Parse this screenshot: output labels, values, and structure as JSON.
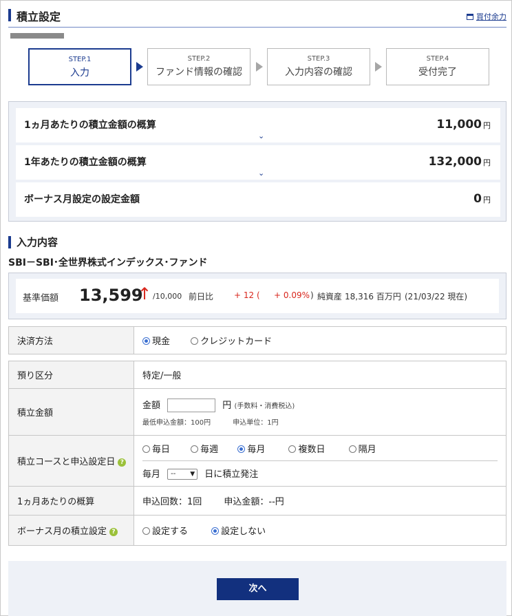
{
  "header": {
    "title": "積立設定",
    "link_label": "買付余力"
  },
  "steps": [
    {
      "num": "STEP.1",
      "label": "入力"
    },
    {
      "num": "STEP.2",
      "label": "ファンド情報の確認"
    },
    {
      "num": "STEP.3",
      "label": "入力内容の確認"
    },
    {
      "num": "STEP.4",
      "label": "受付完了"
    }
  ],
  "summary": [
    {
      "label": "1ヵ月あたりの積立金額の概算",
      "amount": "11,000",
      "unit": "円"
    },
    {
      "label": "1年あたりの積立金額の概算",
      "amount": "132,000",
      "unit": "円"
    },
    {
      "label": "ボーナス月設定の設定金額",
      "amount": "0",
      "unit": "円"
    }
  ],
  "section": {
    "title": "入力内容"
  },
  "fund": {
    "name": "SBI－SBI･全世界株式インデックス･ファンド"
  },
  "price": {
    "label": "基準価額",
    "value": "13,599",
    "arrow": "↑",
    "denominator": "/10,000",
    "change_label": "前日比",
    "change": "+ 12 (",
    "change_pct": "+ 0.09%",
    "change_close": ")",
    "nav_label": "純資産",
    "nav_value": "18,316 百万円",
    "as_of": "(21/03/22 現在)"
  },
  "payment": {
    "label": "決済方法",
    "options": [
      {
        "label": "現金",
        "selected": true
      },
      {
        "label": "クレジットカード",
        "selected": false
      }
    ]
  },
  "form": {
    "deposit": {
      "label": "預り区分",
      "value": "特定/一般"
    },
    "amount": {
      "label": "積立金額",
      "prefix": "金額",
      "input_value": "",
      "unit": "円",
      "note": "(手数料・消費税込)",
      "min_label": "最低申込金額：100円",
      "unit_label": "申込単位：1円"
    },
    "course": {
      "label": "積立コースと申込設定日",
      "options": [
        {
          "label": "毎日",
          "selected": false
        },
        {
          "label": "毎週",
          "selected": false
        },
        {
          "label": "毎月",
          "selected": true
        },
        {
          "label": "複数日",
          "selected": false
        },
        {
          "label": "隔月",
          "selected": false
        }
      ],
      "day_prefix": "毎月",
      "day_select": "--",
      "day_suffix": "日に積立発注"
    },
    "monthly": {
      "label": "1ヵ月あたりの概算",
      "count": "申込回数：1回",
      "amount": "申込金額：--円"
    },
    "bonus": {
      "label": "ボーナス月の積立設定",
      "options": [
        {
          "label": "設定する",
          "selected": false
        },
        {
          "label": "設定しない",
          "selected": true
        }
      ]
    }
  },
  "footer": {
    "next_label": "次へ"
  },
  "colors": {
    "brand": "#1b3b8f",
    "up": "#d8261c",
    "help": "#9bc13a",
    "panel": "#eef1f7"
  },
  "icons": {
    "link": "window-icon",
    "help": "question-icon",
    "chevron": "chevron-down-icon",
    "step_arrow": "triangle-right-icon",
    "price_arrow": "up-arrow-icon"
  }
}
